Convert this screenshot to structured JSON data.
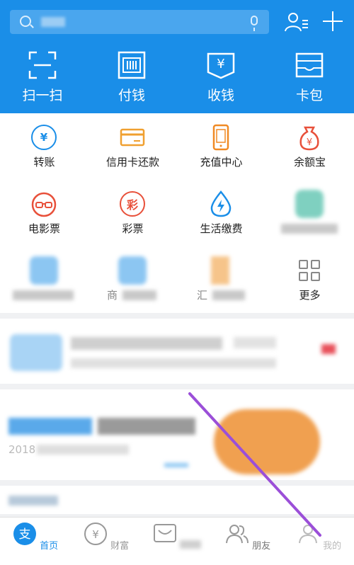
{
  "header": {
    "search": {
      "placeholder": ""
    },
    "actions": [
      {
        "label": "扫一扫",
        "icon": "scan-icon"
      },
      {
        "label": "付钱",
        "icon": "pay-icon"
      },
      {
        "label": "收钱",
        "icon": "receive-money-icon"
      },
      {
        "label": "卡包",
        "icon": "card-wallet-icon"
      }
    ]
  },
  "grid": {
    "items": [
      {
        "label": "转账",
        "icon": "transfer-icon",
        "color": "#1a8ee8"
      },
      {
        "label": "信用卡还款",
        "icon": "credit-card-icon",
        "color": "#f0a030"
      },
      {
        "label": "充值中心",
        "icon": "phone-topup-icon",
        "color": "#f08a24"
      },
      {
        "label": "余额宝",
        "icon": "money-bag-icon",
        "color": "#e8503a"
      },
      {
        "label": "电影票",
        "icon": "movie-ticket-icon",
        "color": "#e8503a"
      },
      {
        "label": "彩票",
        "icon": "lottery-icon",
        "color": "#e8503a"
      },
      {
        "label": "生活缴费",
        "icon": "utility-bill-icon",
        "color": "#1a8ee8"
      },
      {
        "label": "",
        "icon": "blurred-app-icon",
        "color": "#7fd0c0"
      },
      {
        "label": "",
        "icon": "blurred-app-icon",
        "color": "#8cc6f2"
      },
      {
        "label": "商",
        "icon": "blurred-app-icon",
        "color": "#8cc6f2"
      },
      {
        "label": "汇",
        "icon": "blurred-app-icon",
        "color": "#f6c48a"
      },
      {
        "label": "更多",
        "icon": "more-grid-icon",
        "color": "#888888"
      }
    ]
  },
  "card2": {
    "year_text": "2018"
  },
  "tabbar": {
    "items": [
      {
        "label": "首页",
        "icon": "alipay-home-icon",
        "active": true
      },
      {
        "label": "财富",
        "icon": "wealth-icon",
        "active": false
      },
      {
        "label": "",
        "icon": "koubei-icon",
        "active": false
      },
      {
        "label": "朋友",
        "icon": "friends-icon",
        "active": false
      },
      {
        "label": "我的",
        "icon": "profile-icon",
        "active": false
      }
    ]
  },
  "colors": {
    "brand_blue": "#1a8ee8",
    "annotation_line": "#9b4fd8"
  }
}
